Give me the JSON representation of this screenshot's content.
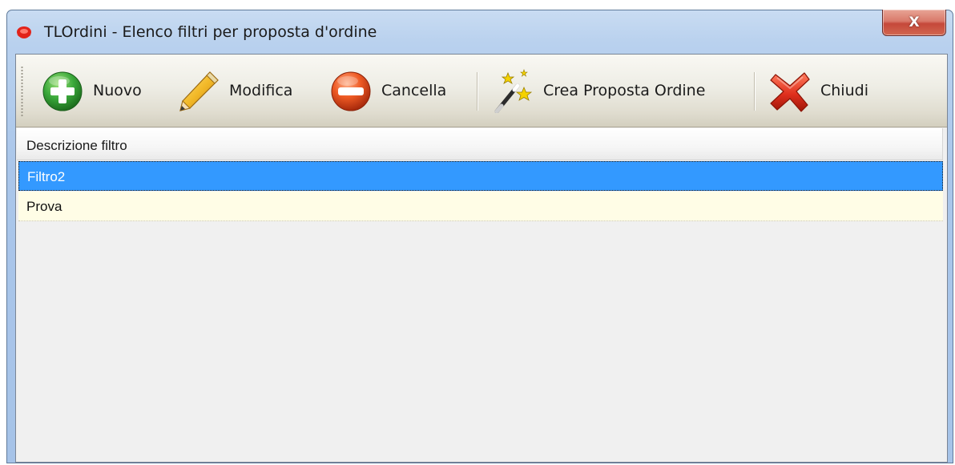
{
  "window": {
    "title": "TLOrdini - Elenco filtri per proposta d'ordine",
    "close_glyph": "X",
    "app_icon": "tlordini-logo-icon"
  },
  "toolbar": {
    "buttons": [
      {
        "id": "nuovo",
        "label": "Nuovo",
        "icon": "add-icon",
        "color": "#2fa62f"
      },
      {
        "id": "modifica",
        "label": "Modifica",
        "icon": "pencil-icon",
        "color": "#f2c94c"
      },
      {
        "id": "cancella",
        "label": "Cancella",
        "icon": "remove-icon",
        "color": "#e8481c"
      },
      {
        "id": "crea",
        "label": "Crea Proposta Ordine",
        "icon": "magic-wand-icon",
        "color": "#f5d200"
      },
      {
        "id": "chiudi",
        "label": "Chiudi",
        "icon": "close-x-icon",
        "color": "#e0301e"
      }
    ]
  },
  "grid": {
    "column_header": "Descrizione filtro",
    "rows": [
      {
        "value": "Filtro2",
        "selected": true
      },
      {
        "value": "Prova",
        "selected": false
      }
    ],
    "colors": {
      "selection": "#3399ff",
      "alternate_row": "#fffde6"
    }
  }
}
